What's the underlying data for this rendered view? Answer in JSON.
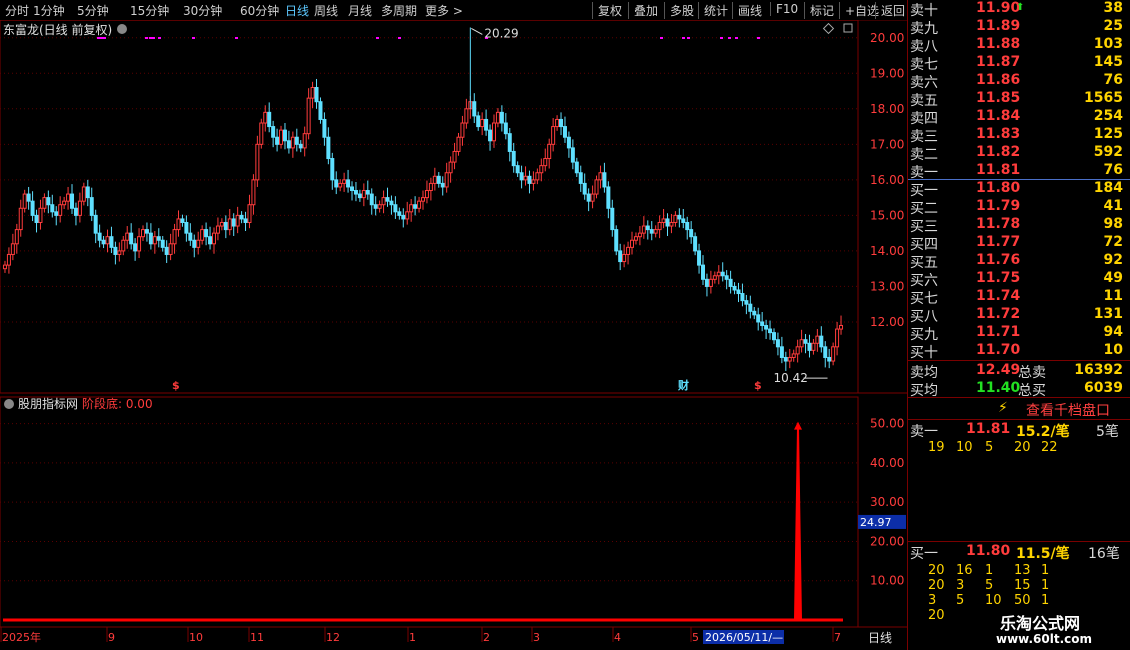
{
  "toolbar": {
    "periods": [
      "分时",
      "1分钟",
      "5分钟",
      "15分钟",
      "30分钟",
      "60分钟",
      "日线",
      "周线",
      "月线",
      "多周期",
      "更多 >"
    ],
    "active_period": "日线",
    "tools": [
      "复权",
      "叠加",
      "多股",
      "统计",
      "画线",
      "F10",
      "标记",
      "+自选",
      "返回"
    ]
  },
  "main_chart": {
    "title": "东富龙(日线 前复权)",
    "high_label": "20.29",
    "low_label": "10.42",
    "y_ticks": [
      "20.00",
      "19.00",
      "18.00",
      "17.00",
      "16.00",
      "15.00",
      "14.00",
      "13.00",
      "12.00"
    ],
    "markers": [
      "$",
      "财",
      "$"
    ]
  },
  "indicator": {
    "title": "股朋指标网",
    "value_label": "阶段底: 0.00",
    "y_ticks": [
      "50.00",
      "40.00",
      "30.00",
      "20.00",
      "10.00"
    ],
    "cursor_value": "24.97"
  },
  "x_axis": {
    "labels": [
      "2025年",
      "9",
      "10",
      "11",
      "12",
      "1",
      "2",
      "3",
      "4",
      "5",
      "7"
    ],
    "cursor_date": "2026/05/11/—",
    "period_label": "日线"
  },
  "order_book": {
    "asks": [
      {
        "label": "卖十",
        "price": "11.90",
        "volume": "38"
      },
      {
        "label": "卖九",
        "price": "11.89",
        "volume": "25"
      },
      {
        "label": "卖八",
        "price": "11.88",
        "volume": "103"
      },
      {
        "label": "卖七",
        "price": "11.87",
        "volume": "145"
      },
      {
        "label": "卖六",
        "price": "11.86",
        "volume": "76"
      },
      {
        "label": "卖五",
        "price": "11.85",
        "volume": "1565"
      },
      {
        "label": "卖四",
        "price": "11.84",
        "volume": "254"
      },
      {
        "label": "卖三",
        "price": "11.83",
        "volume": "125"
      },
      {
        "label": "卖二",
        "price": "11.82",
        "volume": "592"
      },
      {
        "label": "卖一",
        "price": "11.81",
        "volume": "76"
      }
    ],
    "bids": [
      {
        "label": "买一",
        "price": "11.80",
        "volume": "184"
      },
      {
        "label": "买二",
        "price": "11.79",
        "volume": "41"
      },
      {
        "label": "买三",
        "price": "11.78",
        "volume": "98"
      },
      {
        "label": "买四",
        "price": "11.77",
        "volume": "72"
      },
      {
        "label": "买五",
        "price": "11.76",
        "volume": "92"
      },
      {
        "label": "买六",
        "price": "11.75",
        "volume": "49"
      },
      {
        "label": "买七",
        "price": "11.74",
        "volume": "11"
      },
      {
        "label": "买八",
        "price": "11.72",
        "volume": "131"
      },
      {
        "label": "买九",
        "price": "11.71",
        "volume": "94"
      },
      {
        "label": "买十",
        "price": "11.70",
        "volume": "10"
      }
    ],
    "ask_avg_label": "卖均",
    "ask_avg": "12.49",
    "total_sell_label": "总卖",
    "total_sell": "16392",
    "bid_avg_label": "买均",
    "bid_avg": "11.40",
    "total_buy_label": "总买",
    "total_buy": "6039",
    "depth_button": "查看千档盘口",
    "sell1_label": "卖一",
    "sell1_price": "11.81",
    "sell1_per": "15.2/笔",
    "sell1_count": "5笔",
    "sell1_orders": [
      "19",
      "10",
      "5",
      "20",
      "22"
    ],
    "buy1_label": "买一",
    "buy1_price": "11.80",
    "buy1_per": "11.5/笔",
    "buy1_count": "16笔",
    "buy1_orders": [
      [
        "20",
        "16",
        "1",
        "13",
        "1"
      ],
      [
        "20",
        "3",
        "5",
        "15",
        "1"
      ],
      [
        "3",
        "5",
        "10",
        "50",
        "1"
      ],
      [
        "20",
        "",
        "",
        "",
        ""
      ]
    ]
  },
  "watermark": {
    "name": "乐淘公式网",
    "url": "www.60lt.com"
  },
  "colors": {
    "up": "#ff3c3c",
    "down": "#5fe0ff",
    "grid": "#7a0000",
    "ma_line": "#ffffff",
    "signal": "#ff0000",
    "marker": "#ff00ff"
  },
  "chart_data": {
    "type": "candlestick",
    "price_range": [
      10.42,
      20.29
    ],
    "indicator_range": [
      0,
      50
    ],
    "indicator_peak": 49,
    "closes": [
      13.6,
      13.9,
      14.2,
      14.6,
      15.2,
      15.6,
      15.4,
      15.0,
      14.8,
      15.2,
      15.5,
      15.3,
      15.1,
      15.0,
      15.3,
      15.4,
      15.6,
      15.2,
      15.0,
      15.4,
      15.8,
      15.5,
      15.0,
      14.5,
      14.3,
      14.2,
      14.4,
      14.1,
      13.9,
      14.0,
      14.3,
      14.5,
      14.2,
      14.0,
      14.4,
      14.6,
      14.5,
      14.2,
      14.4,
      14.3,
      14.1,
      13.9,
      14.2,
      14.6,
      14.9,
      14.8,
      14.5,
      14.3,
      14.1,
      14.3,
      14.6,
      14.4,
      14.2,
      14.5,
      14.7,
      14.8,
      14.6,
      14.9,
      14.7,
      15.0,
      14.9,
      14.8,
      15.3,
      16.0,
      17.0,
      17.6,
      17.9,
      17.5,
      17.2,
      17.0,
      17.4,
      17.1,
      16.9,
      17.2,
      17.0,
      16.9,
      17.3,
      18.3,
      18.6,
      18.2,
      17.7,
      17.2,
      16.6,
      16.0,
      15.8,
      15.9,
      16.0,
      15.8,
      15.7,
      15.6,
      15.5,
      15.7,
      15.6,
      15.3,
      15.2,
      15.3,
      15.5,
      15.4,
      15.3,
      15.1,
      15.0,
      14.9,
      15.1,
      15.3,
      15.2,
      15.4,
      15.5,
      15.7,
      15.9,
      16.1,
      15.9,
      15.8,
      16.2,
      16.5,
      16.8,
      17.2,
      17.6,
      18.0,
      18.2,
      17.8,
      17.5,
      17.7,
      17.4,
      17.1,
      17.6,
      17.9,
      17.6,
      17.3,
      16.8,
      16.4,
      16.2,
      16.0,
      16.1,
      15.9,
      16.0,
      16.2,
      16.4,
      16.6,
      17.0,
      17.5,
      17.7,
      17.5,
      17.2,
      16.9,
      16.5,
      16.2,
      15.9,
      15.6,
      15.4,
      15.6,
      16.0,
      16.2,
      15.8,
      15.2,
      14.6,
      14.0,
      13.7,
      13.9,
      14.1,
      14.3,
      14.4,
      14.5,
      14.7,
      14.6,
      14.5,
      14.6,
      14.8,
      14.9,
      14.7,
      14.8,
      15.0,
      14.9,
      14.8,
      14.6,
      14.4,
      14.0,
      13.6,
      13.2,
      13.0,
      13.2,
      13.3,
      13.4,
      13.3,
      13.2,
      13.0,
      12.9,
      12.8,
      12.6,
      12.5,
      12.3,
      12.2,
      12.0,
      11.9,
      11.8,
      11.7,
      11.5,
      11.3,
      11.0,
      10.9,
      11.0,
      11.1,
      11.3,
      11.5,
      11.4,
      11.2,
      11.4,
      11.6,
      11.3,
      11.0,
      10.9,
      11.3,
      11.8,
      11.9
    ]
  }
}
